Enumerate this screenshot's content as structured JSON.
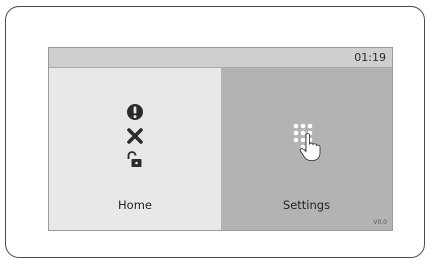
{
  "status_bar": {
    "time": "01:19"
  },
  "tiles": {
    "home": {
      "label": "Home",
      "icons": [
        "alert-icon",
        "close-icon",
        "unlock-icon"
      ]
    },
    "settings": {
      "label": "Settings",
      "icon": "keypad-touch-icon"
    }
  },
  "footer": {
    "version": "V0.0"
  },
  "colors": {
    "screen_background": "#e6e6e6",
    "status_bar": "#cfcfcf",
    "settings_tile": "#b3b3b3",
    "icon_dark": "#2b2b2b",
    "icon_light": "#ffffff",
    "device_border": "#4a4a4a"
  }
}
